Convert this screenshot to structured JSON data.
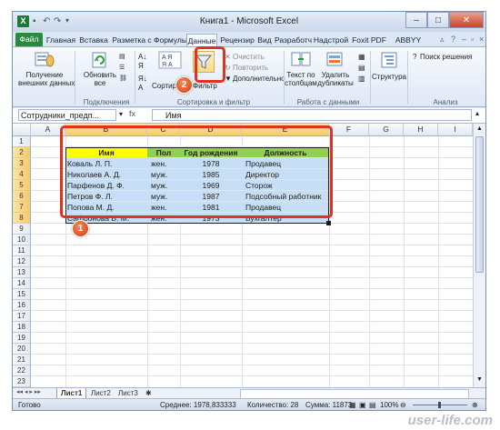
{
  "window": {
    "title": "Книга1  -  Microsoft Excel",
    "app_icon": "X",
    "controls": {
      "minimize": "–",
      "maximize": "□",
      "close": "✕"
    }
  },
  "ribbon_tabs": [
    "Файл",
    "Главная",
    "Вставка",
    "Разметка с",
    "Формулы",
    "Данные",
    "Рецензир",
    "Вид",
    "Разработч",
    "Надстрой",
    "Foxit PDF",
    "ABBYY PDF"
  ],
  "ribbon": {
    "get_external": "Получение\nвнешних данных",
    "refresh_all": "Обновить\nвсе",
    "connections_group": "Подключения",
    "sort": "Сортировка",
    "filter": "Фильтр",
    "clear": "Очистить",
    "reapply": "Повторить",
    "advanced": "Дополнительно",
    "sort_filter_group": "Сортировка и фильтр",
    "text_to_columns": "Текст по\nстолбцам",
    "remove_dupes": "Удалить\nдубликаты",
    "data_tools_group": "Работа с данными",
    "outline": "Структура",
    "solver": "Поиск решения",
    "analysis_group": "Анализ"
  },
  "formula_bar": {
    "name_box": "Сотрудники_предп...",
    "fx": "fx",
    "value": "Имя"
  },
  "columns": [
    "A",
    "B",
    "C",
    "D",
    "E",
    "F",
    "G",
    "H",
    "I"
  ],
  "rows": [
    "1",
    "2",
    "3",
    "4",
    "5",
    "6",
    "7",
    "8",
    "9",
    "10",
    "11",
    "12",
    "13",
    "14",
    "15",
    "16",
    "17",
    "18",
    "19",
    "20",
    "21",
    "22",
    "23"
  ],
  "table": {
    "headers": [
      "Имя",
      "Пол",
      "Год рождения",
      "Должность"
    ],
    "rows": [
      [
        "Коваль Л. П.",
        "жен.",
        "1978",
        "Продавец"
      ],
      [
        "Николаев А. Д.",
        "муж.",
        "1985",
        "Директор"
      ],
      [
        "Парфенов Д. Ф.",
        "муж.",
        "1969",
        "Сторож"
      ],
      [
        "Петров Ф. Л.",
        "муж.",
        "1987",
        "Подсобный работник"
      ],
      [
        "Попова М. Д.",
        "жен.",
        "1981",
        "Продавец"
      ],
      [
        "Сафронова В. М.",
        "жен.",
        "1973",
        "Бухгалтер"
      ]
    ]
  },
  "sheets": [
    "Лист1",
    "Лист2",
    "Лист3"
  ],
  "status": {
    "ready": "Готово",
    "average": "Среднее: 1978,833333",
    "count": "Количество: 28",
    "sum": "Сумма: 11873",
    "zoom": "100%"
  },
  "badges": {
    "one": "1",
    "two": "2"
  },
  "watermark": "user-life.com",
  "colors": {
    "header_fill": "#92d050",
    "header_first": "#ffff00",
    "selection": "#c6dff6",
    "callout": "#e0321e",
    "file_tab": "#2a8a3f"
  }
}
